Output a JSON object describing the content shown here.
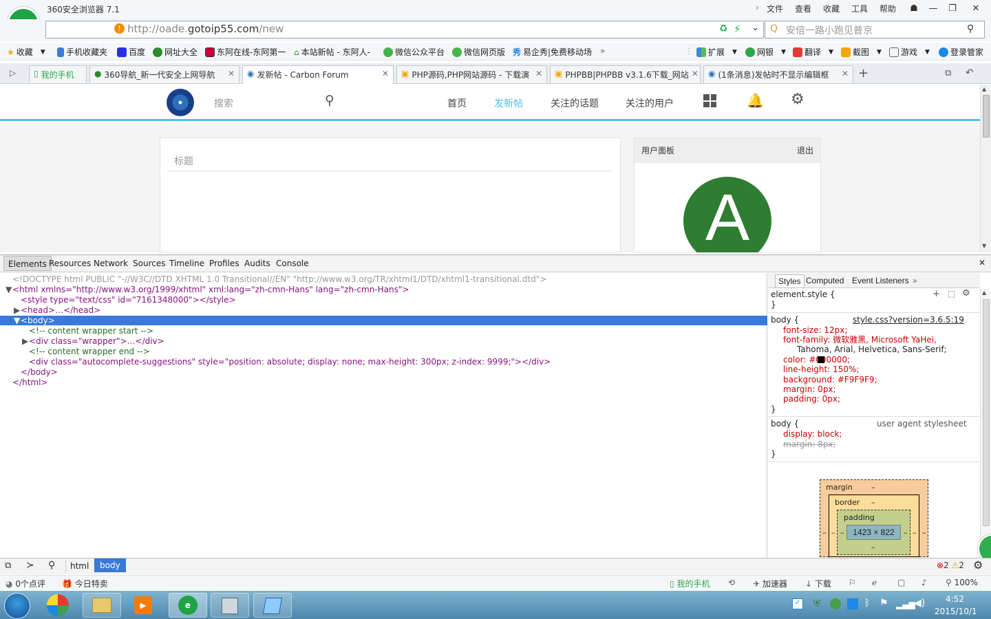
{
  "browser": {
    "app_title": "360安全浏览器 7.1",
    "menus": [
      "文件",
      "查看",
      "收藏",
      "工具",
      "帮助"
    ],
    "url_prefix": "http://oade.",
    "url_domain": "gotoip55.com",
    "url_path": "/new",
    "search_placeholder": "安倍一路小跑见普京"
  },
  "bookmarks": [
    "收藏",
    "手机收藏夹",
    "百度",
    "网址大全",
    "东阿在线-东阿第一",
    "本站新帖 - 东阿人-",
    "微信公众平台",
    "微信网页版",
    "易企秀|免费移动场"
  ],
  "tools": [
    "扩展",
    "网银",
    "翻译",
    "截图",
    "游戏",
    "登录管家"
  ],
  "tabs": [
    {
      "label": "我的手机"
    },
    {
      "label": "360导航_新一代安全上网导航"
    },
    {
      "label": "发新帖 - Carbon Forum"
    },
    {
      "label": "PHP源码,PHP网站源码 - 下载演"
    },
    {
      "label": "PHPBB|PHPBB v3.1.6下载_网站"
    },
    {
      "label": "(1条消息)发帖时不显示编辑框"
    }
  ],
  "site": {
    "search_placeholder": "搜索",
    "nav": [
      "首页",
      "发新帖",
      "关注的话题",
      "关注的用户"
    ],
    "title_placeholder": "标题",
    "panel_title": "用户面板",
    "logout": "退出",
    "avatar_letter": "A"
  },
  "devtools": {
    "tabs": [
      "Elements",
      "Resources",
      "Network",
      "Sources",
      "Timeline",
      "Profiles",
      "Audits",
      "Console"
    ],
    "side_tabs": [
      "Styles",
      "Computed",
      "Event Listeners"
    ],
    "dom": {
      "doctype": "<!DOCTYPE html PUBLIC \"-//W3C//DTD XHTML 1.0 Transitional//EN\" \"http://www.w3.org/TR/xhtml1/DTD/xhtml1-transitional.dtd\">",
      "html_open": "<html xmlns=\"http://www.w3.org/1999/xhtml\" xml:lang=\"zh-cmn-Hans\" lang=\"zh-cmn-Hans\">",
      "style_tag": "<style type=\"text/css\" id=\"7161348000\"></style>",
      "head": "<head>…</head>",
      "body_open": "<body>",
      "comment_start": "<!-- content wrapper start -->",
      "wrapper": "<div class=\"wrapper\">…</div>",
      "comment_end": "<!-- content wrapper end -->",
      "autocomplete": "<div class=\"autocomplete-suggestions\" style=\"position: absolute; display: none; max-height: 300px; z-index: 9999;\"></div>",
      "body_close": "</body>",
      "html_close": "</html>"
    },
    "styles": {
      "element_style": "element.style {",
      "close_brace": "}",
      "body_selector": "body {",
      "source": "style.css?version=3.6.5:19",
      "font_size": "font-size: 12px;",
      "font_family": "font-family: 微软雅黑, Microsoft YaHei,",
      "font_family_cont": "Tahoma, Arial, Helvetica, Sans-Serif;",
      "color": "color: #000000;",
      "line_height": "line-height: 150%;",
      "background": "background: #F9F9F9;",
      "margin": "margin: 0px;",
      "padding": "padding: 0px;",
      "ua_source": "user agent stylesheet",
      "display": "display: block;",
      "ua_margin": "margin: 8px;"
    },
    "box_model": {
      "margin": "margin",
      "border": "border",
      "padding": "padding",
      "dash": "–",
      "content": "1423 × 822"
    },
    "crumbs": [
      "html",
      "body"
    ],
    "errors": "2",
    "warnings": "2"
  },
  "status": {
    "reviews": "0个点评",
    "deals": "今日特卖",
    "phone": "我的手机",
    "accelerator": "加速器",
    "download": "下载",
    "zoom": "100%"
  },
  "clock": {
    "time": "4:52",
    "date": "2015/10/1"
  },
  "colors": {
    "accent": "#4fc1e9",
    "selection": "#3879d9",
    "avatar": "#2e7d32",
    "browser_green": "#1ea345"
  }
}
